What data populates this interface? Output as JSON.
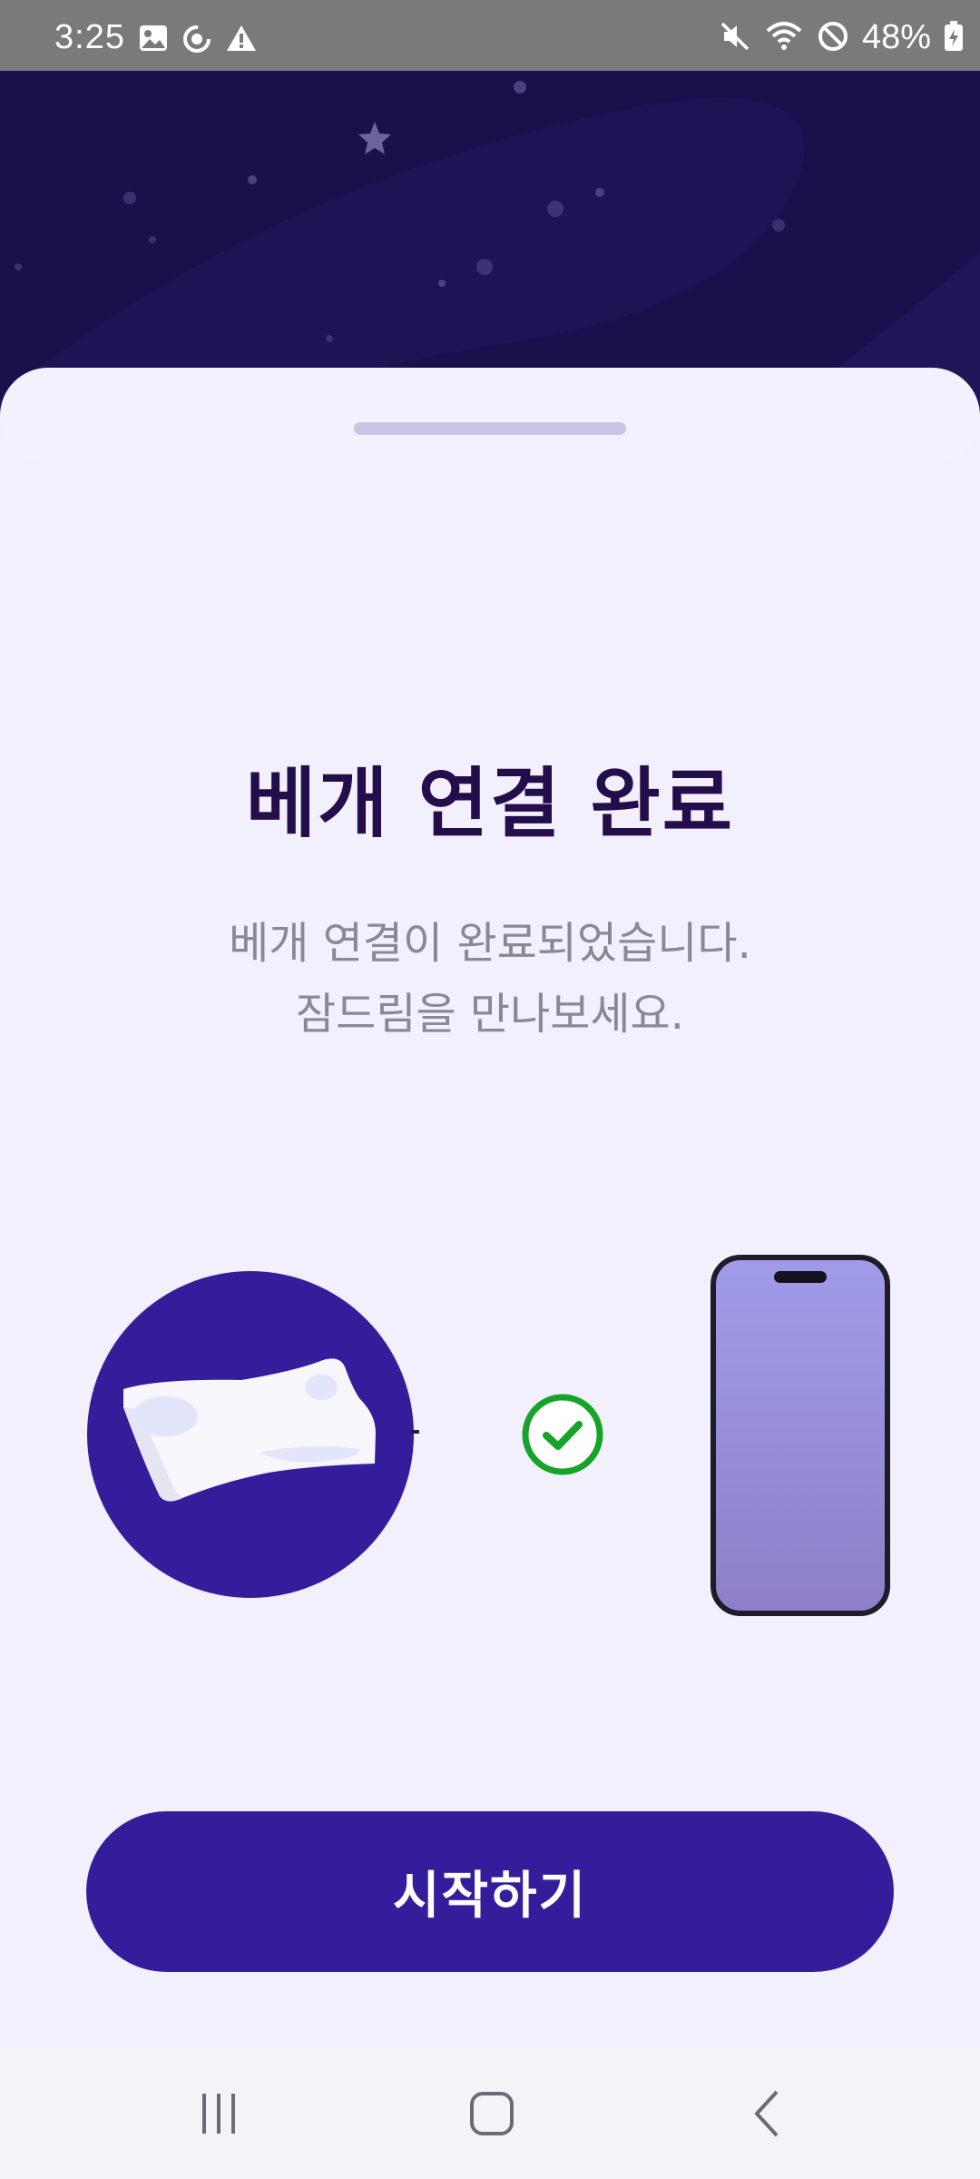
{
  "status_bar": {
    "time": "3:25",
    "battery": "48%",
    "left_icons": [
      "image-icon",
      "sync-icon",
      "warning-icon"
    ],
    "right_icons": [
      "mute-icon",
      "wifi-icon",
      "do-not-disturb-icon",
      "battery-charging-icon"
    ]
  },
  "content": {
    "title": "베개 연결 완료",
    "subtitle_line1": "베개 연결이 완료되었습니다.",
    "subtitle_line2": "잠드림을 만나보세요."
  },
  "illustration": {
    "left": "pillow-icon",
    "middle": "check-circle-icon",
    "right": "phone-icon"
  },
  "actions": {
    "start_label": "시작하기"
  },
  "nav_bar": {
    "buttons": [
      "recent-apps-icon",
      "home-icon",
      "back-icon"
    ]
  },
  "colors": {
    "primary": "#351c9b",
    "title": "#230d4a",
    "sky": "#1b0f4c",
    "sheet_background": "#f1f0fc",
    "success": "#16a32a"
  }
}
